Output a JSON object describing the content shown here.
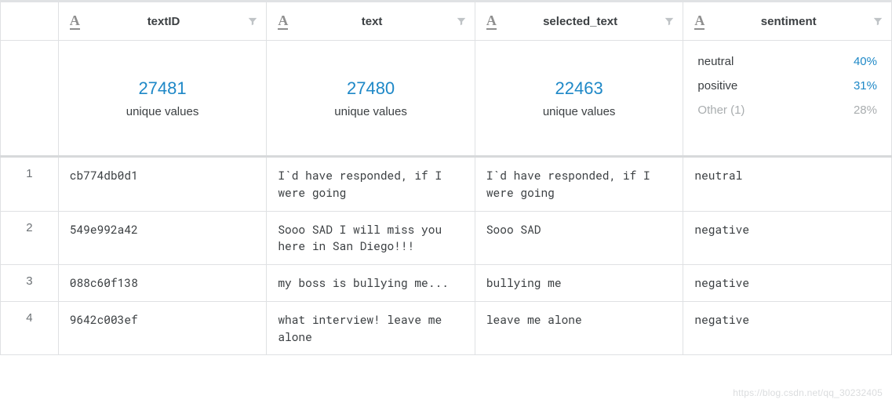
{
  "columns": [
    {
      "name": "textID",
      "summary": {
        "kind": "unique",
        "count": "27481",
        "label": "unique values"
      }
    },
    {
      "name": "text",
      "summary": {
        "kind": "unique",
        "count": "27480",
        "label": "unique values"
      }
    },
    {
      "name": "selected_text",
      "summary": {
        "kind": "unique",
        "count": "22463",
        "label": "unique values"
      }
    },
    {
      "name": "sentiment",
      "summary": {
        "kind": "dist",
        "items": [
          {
            "label": "neutral",
            "pct": "40%",
            "muted": false
          },
          {
            "label": "positive",
            "pct": "31%",
            "muted": false
          },
          {
            "label": "Other (1)",
            "pct": "28%",
            "muted": true
          }
        ]
      }
    }
  ],
  "rows": [
    {
      "n": "1",
      "cells": [
        "cb774db0d1",
        "I`d have responded, if I were going",
        "I`d have responded, if I were going",
        "neutral"
      ]
    },
    {
      "n": "2",
      "cells": [
        "549e992a42",
        "Sooo SAD I will miss you here in San Diego!!!",
        "Sooo SAD",
        "negative"
      ]
    },
    {
      "n": "3",
      "cells": [
        "088c60f138",
        "my boss is bullying me...",
        "bullying me",
        "negative"
      ]
    },
    {
      "n": "4",
      "cells": [
        "9642c003ef",
        "what interview! leave me alone",
        "leave me alone",
        "negative"
      ]
    }
  ],
  "watermark": "https://blog.csdn.net/qq_30232405"
}
